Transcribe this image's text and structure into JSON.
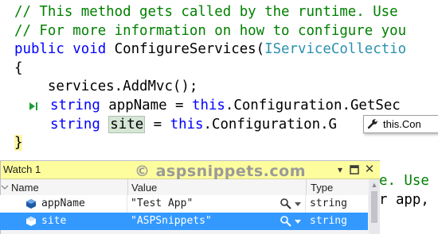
{
  "code": {
    "line1": "// This method gets called by the runtime. Use",
    "line2": "// For more information on how to configure you",
    "line3_kw": "public void ",
    "line3_name": "ConfigureServices(",
    "line3_type": "IServiceCollectio",
    "line4": "{",
    "line5": "    services.AddMvc();",
    "line6_kw": "string ",
    "line6_mid": "appName = ",
    "line6_this": "this",
    "line6_rest": ".Configuration.GetSec",
    "line7_kw": "string ",
    "line7_var": "site",
    "line7_eq": " = ",
    "line7_this": "this",
    "line7_rest": ".Configuration.G",
    "line8": "}",
    "bg_line_comment": "e. Use",
    "bg_line_code": "r app,"
  },
  "datatip": {
    "text": "this.Con"
  },
  "watch": {
    "title": "Watch 1",
    "watermark": "© aspsnippets.com",
    "columns": {
      "name": "Name",
      "value": "Value",
      "type": "Type"
    },
    "rows": [
      {
        "name": "appName",
        "value": "\"Test App\"",
        "type": "string"
      },
      {
        "name": "site",
        "value": "\"ASPSnippets\"",
        "type": "string"
      }
    ]
  },
  "colors": {
    "comment": "#008000",
    "keyword": "#0000ff",
    "type": "#2b91af",
    "selection": "#3399ff",
    "watch_title_bg": "#fdfd9e"
  }
}
